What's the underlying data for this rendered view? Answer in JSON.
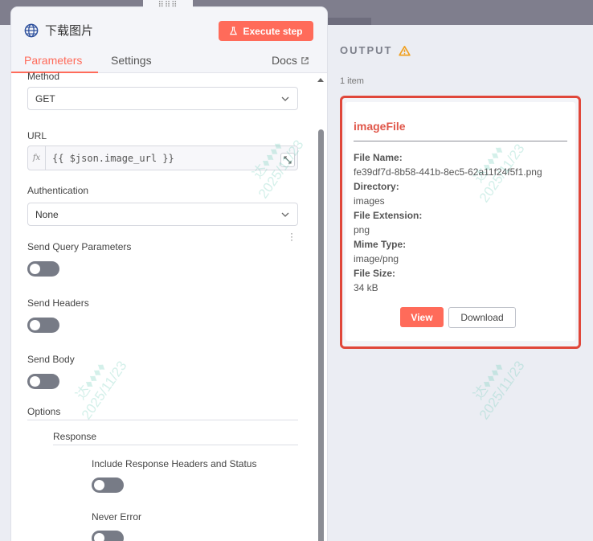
{
  "node": {
    "title": "下载图片",
    "execute_label": "Execute step"
  },
  "tabs": {
    "parameters": "Parameters",
    "settings": "Settings",
    "docs": "Docs"
  },
  "params": {
    "method_label": "Method",
    "method_value": "GET",
    "url_label": "URL",
    "url_fx": "fx",
    "url_value": "{{ $json.image_url }}",
    "auth_label": "Authentication",
    "auth_value": "None",
    "send_query_label": "Send Query Parameters",
    "send_query_on": false,
    "send_headers_label": "Send Headers",
    "send_headers_on": false,
    "send_body_label": "Send Body",
    "send_body_on": false,
    "options_label": "Options",
    "response_label": "Response",
    "include_headers_label": "Include Response Headers and Status",
    "include_headers_on": false,
    "never_error_label": "Never Error",
    "never_error_on": false
  },
  "output": {
    "title": "OUTPUT",
    "count": "1 item",
    "file": {
      "title": "imageFile",
      "file_name_key": "File Name:",
      "file_name": "fe39df7d-8b58-441b-8ec5-62a11f24f5f1.png",
      "directory_key": "Directory:",
      "directory": "images",
      "extension_key": "File Extension:",
      "extension": "png",
      "mime_key": "Mime Type:",
      "mime": "image/png",
      "size_key": "File Size:",
      "size": "34 kB",
      "view_label": "View",
      "download_label": "Download"
    }
  },
  "watermark": {
    "name": "达♦♦♦♦",
    "date": "2025/11/23"
  },
  "colors": {
    "accent": "#ff6b5a",
    "highlight_border": "#e0473a",
    "warning": "#f0a020"
  }
}
